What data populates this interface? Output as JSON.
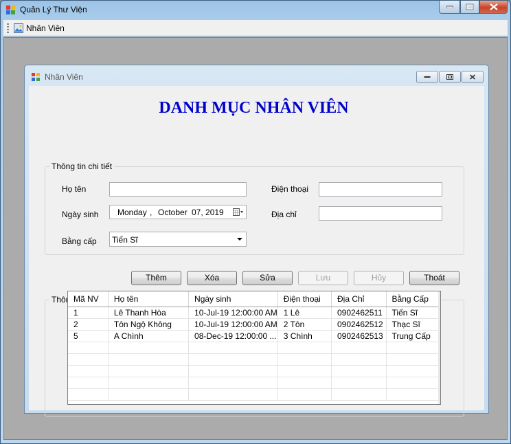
{
  "app": {
    "title": "Quản Lý Thư Viện",
    "menu": {
      "nhanvien_label": "Nhân Viên"
    }
  },
  "child_window": {
    "title": "Nhân Viên"
  },
  "form": {
    "heading": "DANH MỤC NHÂN VIÊN",
    "details_group": "Thông tin chi tiết",
    "general_group": "Thông tin chung",
    "labels": {
      "ho_ten": "Họ tên",
      "ngay_sinh": "Ngày sinh",
      "bang_cap": "Bằng cấp",
      "dien_thoai": "Điện thoại",
      "dia_chi": "Địa chỉ"
    },
    "values": {
      "ho_ten": "",
      "dien_thoai": "",
      "dia_chi": "",
      "date_weekday": "Monday",
      "date_sep": ",",
      "date_month": "October",
      "date_dayyear": "07, 2019",
      "bang_cap": "Tiến Sĩ"
    },
    "buttons": {
      "them": "Thêm",
      "xoa": "Xóa",
      "sua": "Sửa",
      "luu": "Lưu",
      "huy": "Hủy",
      "thoat": "Thoát"
    }
  },
  "grid": {
    "columns": [
      "Mã NV",
      "Họ tên",
      "Ngày sinh",
      "Điện thoại",
      "Địa Chỉ",
      "Bằng Cấp"
    ],
    "rows": [
      [
        "1",
        "Lê Thanh Hòa",
        "10-Jul-19 12:00:00 AM",
        "1 Lê",
        "0902462511",
        "Tiến Sĩ"
      ],
      [
        "2",
        "Tôn Ngộ Không",
        "10-Jul-19 12:00:00 AM",
        "2 Tôn",
        "0902462512",
        "Thạc Sĩ"
      ],
      [
        "5",
        "A Chình",
        "08-Dec-19 12:00:00 ...",
        "3 Chình",
        "0902462513",
        "Trung Cấp"
      ]
    ]
  }
}
